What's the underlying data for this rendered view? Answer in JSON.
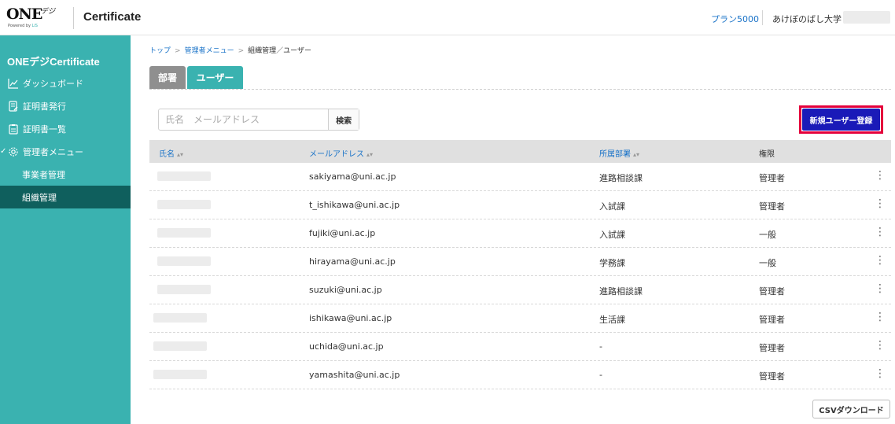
{
  "header": {
    "logo_text": "ONE",
    "logo_sub": "デジ",
    "logo_tagline": "Powered by ",
    "logo_tagline_accent": "LiS",
    "app_title": "Certificate",
    "plan_link": "プラン5000",
    "org_name": "あけぼのばし大学"
  },
  "sidebar": {
    "title": "ONEデジCertificate",
    "items": [
      {
        "label": "ダッシュボード",
        "icon": "chart-icon"
      },
      {
        "label": "証明書発行",
        "icon": "certificate-issue-icon"
      },
      {
        "label": "証明書一覧",
        "icon": "certificate-list-icon"
      },
      {
        "label": "管理者メニュー",
        "icon": "gear-icon",
        "expanded": true
      },
      {
        "label": "事業者管理",
        "sub": true
      },
      {
        "label": "組織管理",
        "sub": true,
        "active": true
      }
    ]
  },
  "breadcrumb": {
    "top": "トップ",
    "admin": "管理者メニュー",
    "current": "組織管理／ユーザー",
    "separator": ">"
  },
  "tabs": {
    "dept": "部署",
    "user": "ユーザー"
  },
  "search": {
    "placeholder": "氏名　メールアドレス",
    "button": "検索"
  },
  "new_user_button": "新規ユーザー登録",
  "table": {
    "headers": {
      "name": "氏名",
      "email": "メールアドレス",
      "dept": "所属部署",
      "role": "権限"
    },
    "rows": [
      {
        "email": "sakiyama@uni.ac.jp",
        "dept": "進路相談課",
        "role": "管理者"
      },
      {
        "email": "t_ishikawa@uni.ac.jp",
        "dept": "入試課",
        "role": "管理者"
      },
      {
        "email": "fujiki@uni.ac.jp",
        "dept": "入試課",
        "role": "一般"
      },
      {
        "email": "hirayama@uni.ac.jp",
        "dept": "学務課",
        "role": "一般"
      },
      {
        "email": "suzuki@uni.ac.jp",
        "dept": "進路相談課",
        "role": "管理者"
      },
      {
        "email": "ishikawa@uni.ac.jp",
        "dept": "生活課",
        "role": "管理者"
      },
      {
        "email": "uchida@uni.ac.jp",
        "dept": "-",
        "role": "管理者"
      },
      {
        "email": "yamashita@uni.ac.jp",
        "dept": "-",
        "role": "管理者"
      }
    ]
  },
  "csv_button": "CSVダウンロード",
  "colors": {
    "accent": "#3ab2b0",
    "sidebar_active": "#0f5f5d",
    "primary_button": "#1a1ab8",
    "highlight_border": "#e4003b",
    "link": "#1a73c8"
  }
}
